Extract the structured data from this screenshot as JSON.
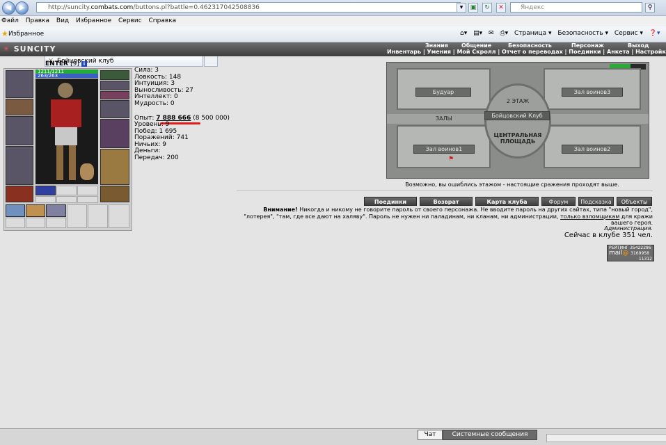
{
  "browser": {
    "url_host": "http://suncity.",
    "url_domain": "combats.com",
    "url_path": "/buttons.pl?battle=0.462317042508836",
    "search_placeholder": "Яндекс",
    "menu": [
      "Файл",
      "Правка",
      "Вид",
      "Избранное",
      "Сервис",
      "Справка"
    ],
    "favorites_label": "Избранное",
    "tab_title": "Бойцовский клуб",
    "toolbar_right": [
      "Страница ▾",
      "Безопасность ▾",
      "Сервис ▾"
    ]
  },
  "game": {
    "logo": "SUNCITY",
    "nav_top": [
      "Знания",
      "Общение",
      "Безопасность",
      "Персонаж",
      "Выход"
    ],
    "nav_sub": "Инвентарь | Умения | Мой Скролл | Отчет о переводах | Поединки | Анкета | Настройки",
    "character": {
      "name": "ENTER",
      "level_tag": "[9]",
      "hp": "1211/1211",
      "mana": "263/263"
    },
    "stats": {
      "strength": "Сила: 3",
      "agility": "Ловкость: 148",
      "intuition": "Интуиция: 3",
      "endurance": "Выносливость: 27",
      "intellect": "Интеллект: 0",
      "wisdom": "Мудрость: 0",
      "exp_label": "Опыт:",
      "exp_value": "7 888 666",
      "exp_next": "(8 500 000)",
      "level": "Уровень: 9",
      "wins": "Побед: 1 695",
      "losses": "Поражений: 741",
      "draws": "Ничьих: 9",
      "money": "Деньги:",
      "transfers": "Передач: 200"
    },
    "map": {
      "rooms": {
        "boudoir": "Будуар",
        "warriors3": "Зал воинов3",
        "floor2": "2 ЭТАЖ",
        "club": "Бойцовский Клуб",
        "halls": "ЗАЛЫ",
        "central": "ЦЕНТРАЛЬНАЯ ПЛОЩАДЬ",
        "warriors1": "Зал воинов1",
        "warriors2": "Зал воинов2"
      },
      "caption": "Возможно, вы ошиблись этажом - настоящие сражения проходят выше."
    },
    "buttons": {
      "battles": "Поединки",
      "back": "Возврат",
      "club_map": "Карта клуба",
      "forum": "Форум",
      "hint": "Подсказка",
      "objects": "Объекты"
    },
    "warning": {
      "title": "Внимание!",
      "text1": " Никогда и никому не говорите пароль от своего персонажа. Не вводите пароль на других сайтах, типа \"новый город\", \"лотерея\", \"там, где все дают на халяву\". Пароль не нужен ни паладинам, ни кланам, ни администрации, ",
      "link": "только взломщикам",
      "text2": " для кражи вашего героя.",
      "signature": "Администрация."
    },
    "online": "Сейчас в клубе 351 чел.",
    "rating": {
      "label": "РЕЙТИНГ",
      "brand": "mail",
      "n1": "35422286",
      "n2": "3169958",
      "n3": "11312"
    },
    "bottom_tabs": {
      "chat": "Чат",
      "system": "Системные сообщения"
    }
  }
}
